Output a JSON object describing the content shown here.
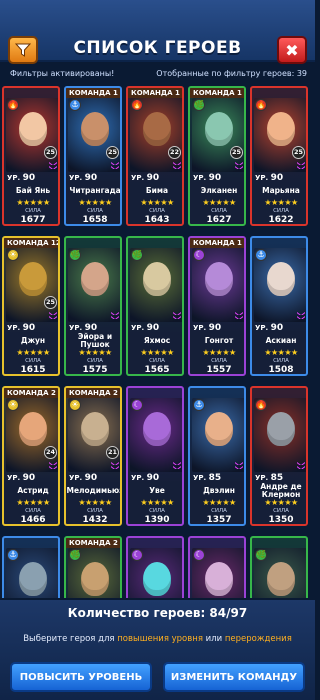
{
  "header": {
    "title": "СПИСОК ГЕРОЕВ",
    "filter_icon": "funnel-icon",
    "close_icon": "close-icon",
    "close_glyph": "✖"
  },
  "filter_bar": {
    "status": "Фильтры активированы!",
    "count_text": "Отобранные по фильтру героев: 39"
  },
  "heroes": [
    {
      "team": "",
      "level": "90",
      "name": "Бай Янь",
      "power": "1677",
      "badge": "25",
      "frame": "#d9342b",
      "bg": "#b5372f",
      "skin": "#f2c7a4",
      "elem": "🔥"
    },
    {
      "team": "КОМАНДА 1",
      "level": "90",
      "name": "Читрангада",
      "power": "1658",
      "badge": "25",
      "frame": "#3d8be8",
      "bg": "#2f6fb6",
      "skin": "#c9906a",
      "elem": "⚓"
    },
    {
      "team": "КОМАНДА 1",
      "level": "90",
      "name": "Бима",
      "power": "1643",
      "badge": "22",
      "frame": "#d9342b",
      "bg": "#a6402a",
      "skin": "#a86a45",
      "elem": "🔥"
    },
    {
      "team": "КОМАНДА 1",
      "level": "90",
      "name": "Элканен",
      "power": "1627",
      "badge": "25",
      "frame": "#37b74a",
      "bg": "#3a8a5a",
      "skin": "#8ac7b0",
      "elem": "🌿"
    },
    {
      "team": "",
      "level": "90",
      "name": "Марьяна",
      "power": "1622",
      "badge": "25",
      "frame": "#d9342b",
      "bg": "#b5432f",
      "skin": "#f0b38a",
      "elem": "🔥"
    },
    {
      "team": "КОМАНДА 12",
      "level": "90",
      "name": "Джун",
      "power": "1615",
      "badge": "25",
      "frame": "#e6c12c",
      "bg": "#9c7a2a",
      "skin": "#c99a3a",
      "elem": "☀"
    },
    {
      "team": "",
      "level": "90",
      "name": "Эйора и Пушок",
      "power": "1575",
      "badge": "",
      "frame": "#37b74a",
      "bg": "#4a7a4a",
      "skin": "#d4a58a",
      "elem": "🌿"
    },
    {
      "team": "",
      "level": "90",
      "name": "Яхмос",
      "power": "1565",
      "badge": "",
      "frame": "#37b74a",
      "bg": "#5a6e38",
      "skin": "#d8c9a0",
      "elem": "🌿"
    },
    {
      "team": "КОМАНДА 1",
      "level": "90",
      "name": "Гонгот",
      "power": "1557",
      "badge": "",
      "frame": "#9b42d6",
      "bg": "#6a3a94",
      "skin": "#b58ad8",
      "elem": "☾"
    },
    {
      "team": "",
      "level": "90",
      "name": "Аскиан",
      "power": "1508",
      "badge": "",
      "frame": "#3d8be8",
      "bg": "#3a6aa8",
      "skin": "#e8d8cf",
      "elem": "⚓"
    },
    {
      "team": "КОМАНДА 2",
      "level": "90",
      "name": "Астрид",
      "power": "1466",
      "badge": "24",
      "frame": "#e6c12c",
      "bg": "#9c6a2a",
      "skin": "#e6a67a",
      "elem": "☀"
    },
    {
      "team": "КОМАНДА 2",
      "level": "90",
      "name": "Мелодимьюз",
      "power": "1432",
      "badge": "21",
      "frame": "#e6c12c",
      "bg": "#8a7050",
      "skin": "#c8b090",
      "elem": "☀"
    },
    {
      "team": "",
      "level": "90",
      "name": "Уве",
      "power": "1390",
      "badge": "",
      "frame": "#9b42d6",
      "bg": "#6a2a8a",
      "skin": "#a86ad8",
      "elem": "☾"
    },
    {
      "team": "",
      "level": "85",
      "name": "Двэлин",
      "power": "1357",
      "badge": "",
      "frame": "#3d8be8",
      "bg": "#3a6aa8",
      "skin": "#e8b08a",
      "elem": "⚓"
    },
    {
      "team": "",
      "level": "85",
      "name": "Андре де Клермон",
      "power": "1350",
      "badge": "",
      "frame": "#d9342b",
      "bg": "#8a3028",
      "skin": "#9aa0a8",
      "elem": "🔥"
    },
    {
      "team": "",
      "level": "",
      "name": "",
      "power": "",
      "badge": "",
      "frame": "#3d8be8",
      "bg": "#2a4a7a",
      "skin": "#8aa0b0",
      "elem": "⚓"
    },
    {
      "team": "КОМАНДА 2",
      "level": "",
      "name": "",
      "power": "",
      "badge": "",
      "frame": "#37b74a",
      "bg": "#5a6a3a",
      "skin": "#c8a070",
      "elem": "🌿"
    },
    {
      "team": "",
      "level": "",
      "name": "",
      "power": "",
      "badge": "",
      "frame": "#9b42d6",
      "bg": "#5a2a7a",
      "skin": "#58d8e0",
      "elem": "☾"
    },
    {
      "team": "",
      "level": "",
      "name": "",
      "power": "",
      "badge": "",
      "frame": "#9b42d6",
      "bg": "#6a2a6a",
      "skin": "#d8b0d8",
      "elem": "☾"
    },
    {
      "team": "",
      "level": "",
      "name": "",
      "power": "",
      "badge": "",
      "frame": "#37b74a",
      "bg": "#3a5a4a",
      "skin": "#c0a080",
      "elem": "🌿"
    }
  ],
  "labels": {
    "level_prefix": "УР.",
    "power_label": "СИЛА",
    "stars": "★★★★★"
  },
  "footer": {
    "count": "Количество героев: 84/97",
    "hint_a": "Выберите героя для ",
    "hint_hl1": "повышения уровня",
    "hint_b": " или ",
    "hint_hl2": "перерождения",
    "btn_level_up": "ПОВЫСИТЬ УРОВЕНЬ",
    "btn_change_team": "ИЗМЕНИТЬ КОМАНДУ"
  }
}
